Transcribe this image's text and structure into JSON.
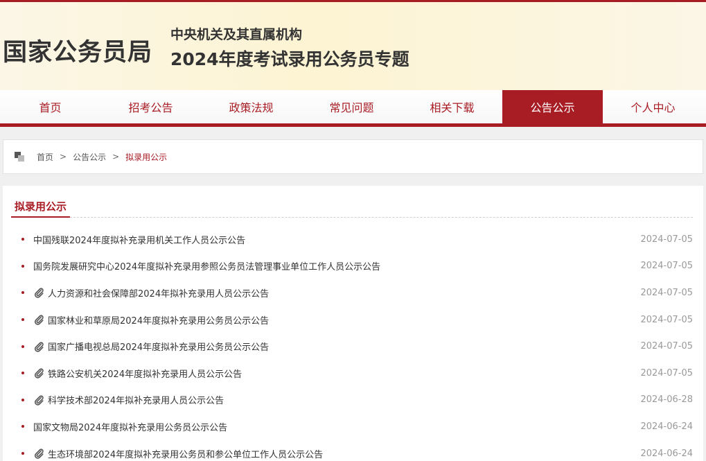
{
  "header": {
    "brand": "国家公务员局",
    "subtitle_line1": "中央机关及其直属机构",
    "subtitle_line2": "2024年度考试录用公务员专题"
  },
  "nav": {
    "items": [
      {
        "label": "首页"
      },
      {
        "label": "招考公告"
      },
      {
        "label": "政策法规"
      },
      {
        "label": "常见问题"
      },
      {
        "label": "相关下载"
      },
      {
        "label": "公告公示"
      },
      {
        "label": "个人中心"
      }
    ],
    "active": "公告公示"
  },
  "breadcrumb": {
    "home": "首页",
    "level1": "公告公示",
    "current": "拟录用公示",
    "separator": ">"
  },
  "section": {
    "title": "拟录用公示"
  },
  "list": [
    {
      "title": "中国残联2024年度拟补充录用机关工作人员公示公告",
      "date": "2024-07-05",
      "attachment": false
    },
    {
      "title": "国务院发展研究中心2024年度拟补充录用参照公务员法管理事业单位工作人员公示公告",
      "date": "2024-07-05",
      "attachment": false
    },
    {
      "title": "人力资源和社会保障部2024年拟补充录用人员公示公告",
      "date": "2024-07-05",
      "attachment": true
    },
    {
      "title": "国家林业和草原局2024年度拟补充录用公务员公示公告",
      "date": "2024-07-05",
      "attachment": true
    },
    {
      "title": "国家广播电视总局2024年度拟补充录用公务员公示公告",
      "date": "2024-07-05",
      "attachment": true
    },
    {
      "title": "铁路公安机关2024年度拟补充录用人员公示公告",
      "date": "2024-07-05",
      "attachment": true
    },
    {
      "title": "科学技术部2024年拟补充录用人员公示公告",
      "date": "2024-06-28",
      "attachment": true
    },
    {
      "title": "国家文物局2024年度拟补充录用公务员公示公告",
      "date": "2024-06-24",
      "attachment": false
    },
    {
      "title": "生态环境部2024年度拟补充录用公务员和参公单位工作人员公示公告",
      "date": "2024-06-24",
      "attachment": true
    }
  ],
  "colors": {
    "accent": "#a81c24",
    "date": "#999999"
  },
  "icons": {
    "attachment": "paperclip-icon",
    "breadcrumb": "location-icon"
  }
}
